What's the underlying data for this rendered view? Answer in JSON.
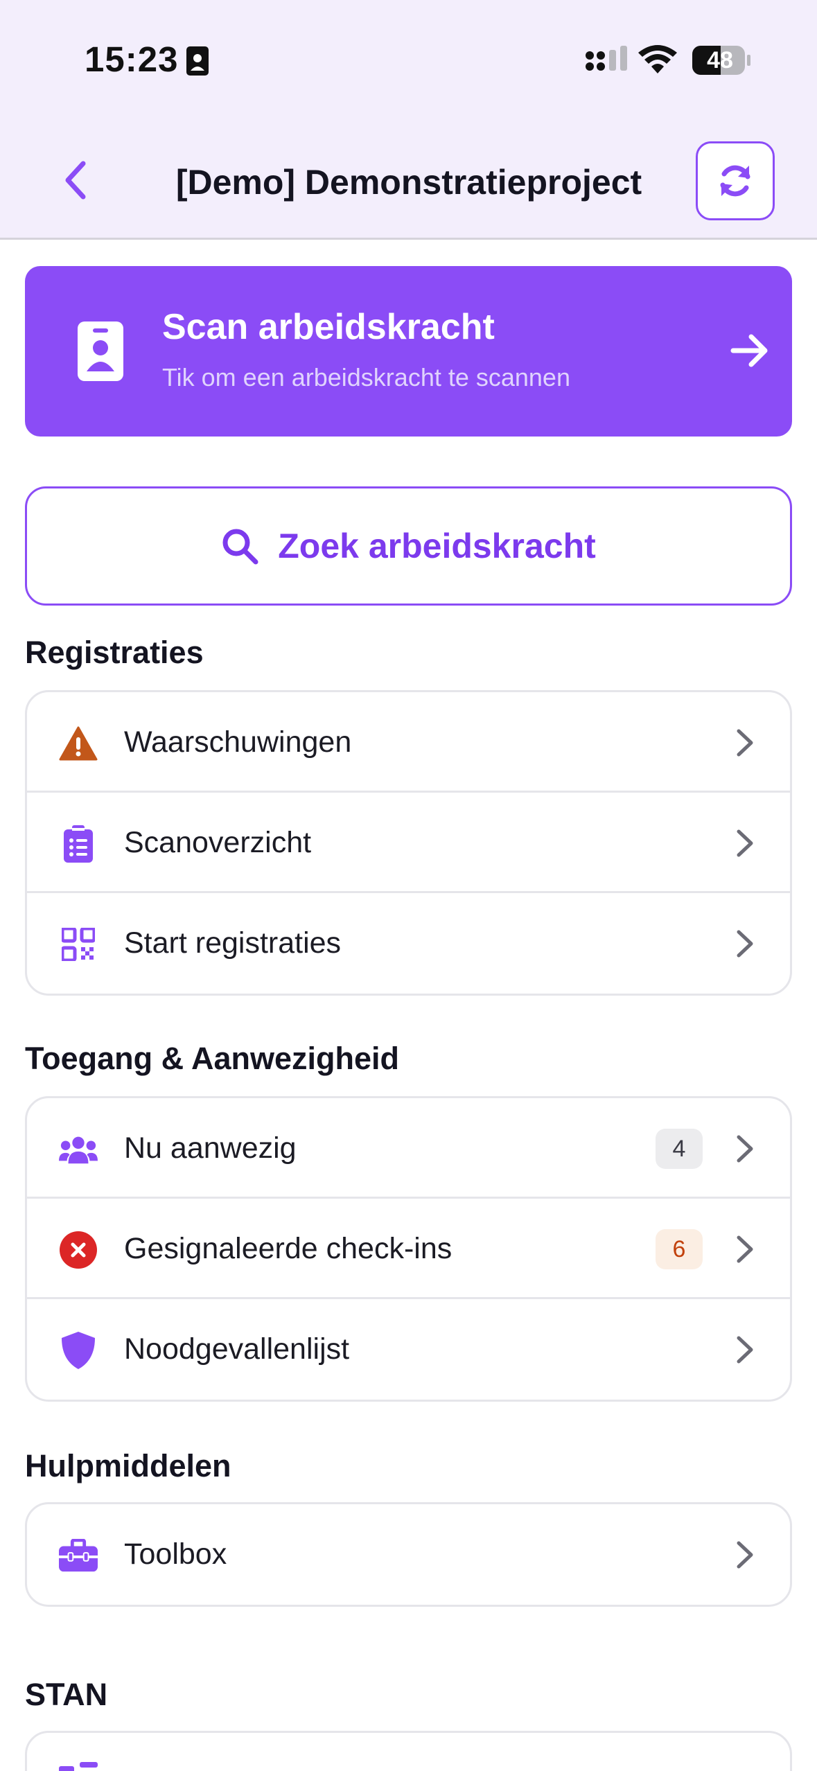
{
  "status_bar": {
    "time": "15:23",
    "battery": "48",
    "icons": [
      "contact-card-icon",
      "cellular-signal-icon",
      "wifi-icon",
      "battery-icon"
    ]
  },
  "header": {
    "back_icon": "chevron-left-icon",
    "title": "[Demo] Demonstratieproject",
    "refresh_icon": "refresh-icon"
  },
  "scan_card": {
    "icon": "badge-icon",
    "title": "Scan arbeidskracht",
    "subtitle": "Tik om een arbeidskracht te scannen",
    "arrow_icon": "arrow-right-icon"
  },
  "search": {
    "icon": "search-icon",
    "label": "Zoek arbeidskracht"
  },
  "sections": {
    "registraties": {
      "title": "Registraties",
      "items": [
        {
          "label": "Waarschuwingen",
          "icon": "warning-icon"
        },
        {
          "label": "Scanoverzicht",
          "icon": "clipboard-list-icon"
        },
        {
          "label": "Start registraties",
          "icon": "qr-code-icon"
        }
      ]
    },
    "toegang": {
      "title": "Toegang & Aanwezigheid",
      "items": [
        {
          "label": "Nu aanwezig",
          "icon": "users-icon",
          "badge": "4"
        },
        {
          "label": "Gesignaleerde check-ins",
          "icon": "error-circle-icon",
          "badge": "6"
        },
        {
          "label": "Noodgevallenlijst",
          "icon": "shield-icon"
        }
      ]
    },
    "hulpmiddelen": {
      "title": "Hulpmiddelen",
      "items": [
        {
          "label": "Toolbox",
          "icon": "toolbox-icon"
        }
      ]
    },
    "stan": {
      "title": "STAN"
    }
  },
  "colors": {
    "accent": "#8b4cf6",
    "header_bg": "#f3eefc",
    "warning": "#c2571a",
    "error": "#dc2626"
  }
}
